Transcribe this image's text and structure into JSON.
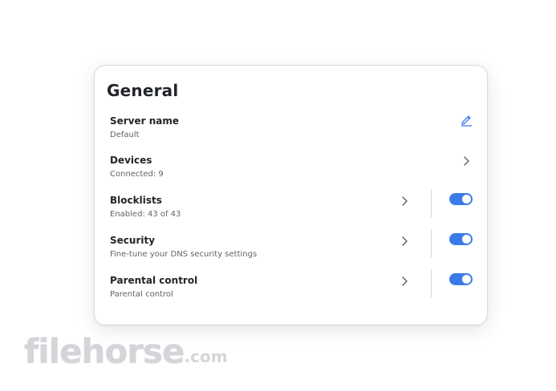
{
  "card": {
    "title": "General",
    "rows": [
      {
        "title": "Server name",
        "subtitle": "Default",
        "action": "edit-icon"
      },
      {
        "title": "Devices",
        "subtitle": "Connected: 9",
        "action": "chevron-right-icon"
      },
      {
        "title": "Blocklists",
        "subtitle": "Enabled: 43 of 43",
        "action": "chevron-right-icon",
        "toggle": true
      },
      {
        "title": "Security",
        "subtitle": "Fine-tune your DNS security settings",
        "action": "chevron-right-icon",
        "toggle": true
      },
      {
        "title": "Parental control",
        "subtitle": "Parental control",
        "action": "chevron-right-icon",
        "toggle": true
      }
    ]
  },
  "colors": {
    "accent": "#3a7bea",
    "title_text": "#22252b",
    "subtitle_text": "#5f636b"
  },
  "watermark": {
    "main": "filehorse",
    "tld": ".com"
  }
}
